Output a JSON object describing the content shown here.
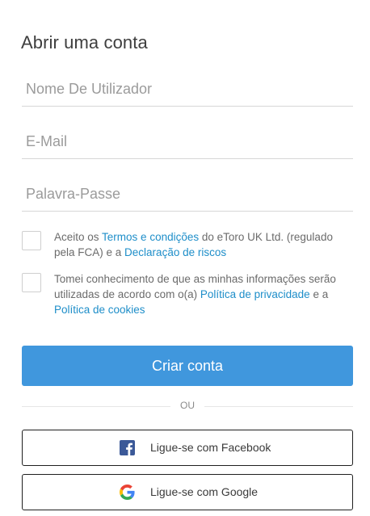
{
  "form": {
    "title": "Abrir uma conta",
    "username_placeholder": "Nome De Utilizador",
    "email_placeholder": "E-Mail",
    "password_placeholder": "Palavra-Passe"
  },
  "consent": {
    "terms": {
      "prefix": "Aceito os ",
      "terms_link": "Termos e condições",
      "middle": " do eToro UK Ltd. (regulado pela FCA) e a ",
      "risk_link": "Declaração de riscos"
    },
    "privacy": {
      "prefix": "Tomei conhecimento de que as minhas informações serão utilizadas de acordo com o(a) ",
      "privacy_link": "Política de privacidade",
      "middle": " e a ",
      "cookies_link": "Política de cookies"
    }
  },
  "actions": {
    "create_label": "Criar conta",
    "or_label": "OU",
    "facebook_label": "Ligue-se com Facebook",
    "google_label": "Ligue-se com Google"
  },
  "colors": {
    "primary": "#4097dd",
    "link": "#1e8ec9",
    "facebook": "#3b5998"
  }
}
